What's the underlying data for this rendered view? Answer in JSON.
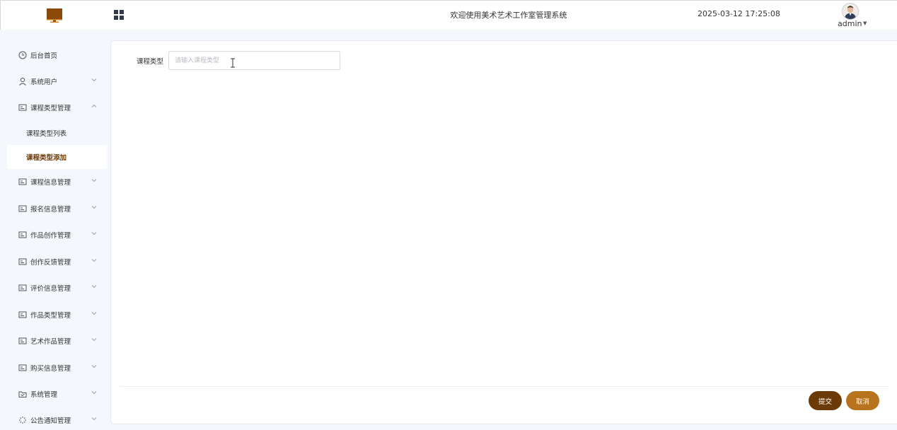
{
  "header": {
    "title": "欢迎使用美术艺术工作室管理系统",
    "datetime": "2025-03-12 17:25:08",
    "username": "admin",
    "logo_icon": "monitor-icon",
    "menu_icon": "grid-menu-icon"
  },
  "sidebar": {
    "items": [
      {
        "label": "后台首页",
        "icon": "clock-icon"
      },
      {
        "label": "系统用户",
        "icon": "user-icon"
      },
      {
        "label": "课程类型管理",
        "icon": "card-icon",
        "expanded": true
      },
      {
        "label": "课程信息管理",
        "icon": "card-icon"
      },
      {
        "label": "报名信息管理",
        "icon": "card-icon"
      },
      {
        "label": "作品创作管理",
        "icon": "card-icon"
      },
      {
        "label": "创作反馈管理",
        "icon": "card-icon"
      },
      {
        "label": "评价信息管理",
        "icon": "card-icon"
      },
      {
        "label": "作品类型管理",
        "icon": "card-icon"
      },
      {
        "label": "艺术作品管理",
        "icon": "card-icon"
      },
      {
        "label": "购买信息管理",
        "icon": "card-icon"
      },
      {
        "label": "系统管理",
        "icon": "inbox-icon"
      },
      {
        "label": "公告通知管理",
        "icon": "spinner-icon"
      }
    ],
    "subitems": [
      {
        "label": "课程类型列表"
      },
      {
        "label": "课程类型添加",
        "active": true
      }
    ]
  },
  "form": {
    "field_label": "课程类型",
    "field_placeholder": "请输入课程类型",
    "field_value": "",
    "submit_label": "提交",
    "cancel_label": "取消"
  },
  "colors": {
    "primary": "#6b3a06",
    "secondary": "#b8731f",
    "background": "#f4f7fc"
  }
}
